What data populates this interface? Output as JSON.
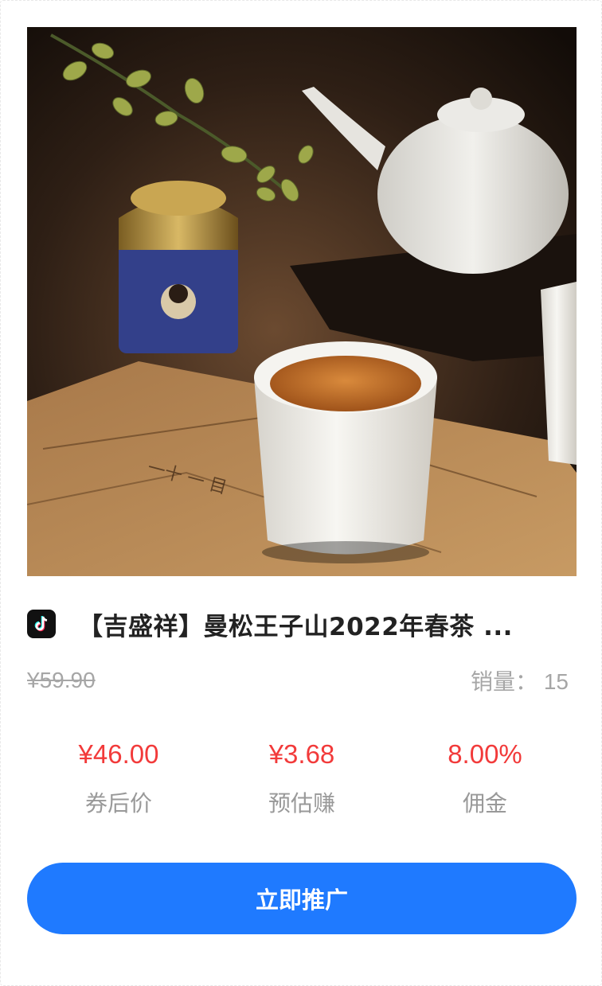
{
  "product": {
    "image_alt": "tea-cup-photo",
    "platform_icon": "douyin-icon",
    "title": "【吉盛祥】曼松王子山2022年春茶 ..."
  },
  "pricing": {
    "original_price": "¥59.90",
    "sales_label": "销量：",
    "sales_count": "15"
  },
  "stats": [
    {
      "value": "¥46.00",
      "label": "券后价"
    },
    {
      "value": "¥3.68",
      "label": "预估赚"
    },
    {
      "value": "8.00%",
      "label": "佣金"
    }
  ],
  "actions": {
    "promote_label": "立即推广"
  },
  "colors": {
    "accent_blue": "#1f7aff",
    "price_red": "#f23a3a",
    "muted_gray": "#a6a6a6"
  }
}
